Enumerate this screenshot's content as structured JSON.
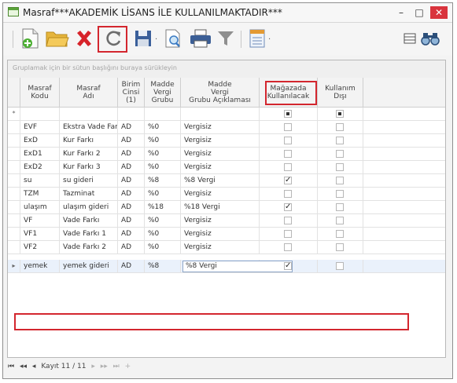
{
  "window": {
    "title": "Masraf***AKADEMİK LİSANS İLE KULLANILMAKTADIR***",
    "minimize": "–",
    "maximize": "□",
    "close": "✕"
  },
  "toolbar": {
    "dropdown_arrow": "·"
  },
  "grid": {
    "group_hint": "Gruplamak için bir sütun başlığını buraya sürükleyin",
    "headers": [
      "Masraf\nKodu",
      "Masraf\nAdı",
      "Birim\nCinsi\n(1)",
      "Madde\nVergi\nGrubu",
      "Madde\nVergi\nGrubu Açıklaması",
      "Mağazada\nKullanılacak",
      "Kullanım\nDışı"
    ],
    "new_row_marker": "*",
    "rows": [
      {
        "kod": "EVF",
        "adi": "Ekstra Vade Farkı",
        "birim": "AD",
        "grup": "%0",
        "aciklama": "Vergisiz",
        "magaza": false,
        "disi": false
      },
      {
        "kod": "ExD",
        "adi": "Kur Farkı",
        "birim": "AD",
        "grup": "%0",
        "aciklama": "Vergisiz",
        "magaza": false,
        "disi": false
      },
      {
        "kod": "ExD1",
        "adi": "Kur Farkı 2",
        "birim": "AD",
        "grup": "%0",
        "aciklama": "Vergisiz",
        "magaza": false,
        "disi": false
      },
      {
        "kod": "ExD2",
        "adi": "Kur Farkı 3",
        "birim": "AD",
        "grup": "%0",
        "aciklama": "Vergisiz",
        "magaza": false,
        "disi": false
      },
      {
        "kod": "su",
        "adi": "su gideri",
        "birim": "AD",
        "grup": "%8",
        "aciklama": "%8 Vergi",
        "magaza": true,
        "disi": false
      },
      {
        "kod": "TZM",
        "adi": "Tazminat",
        "birim": "AD",
        "grup": "%0",
        "aciklama": "Vergisiz",
        "magaza": false,
        "disi": false
      },
      {
        "kod": "ulaşım",
        "adi": "ulaşım gideri",
        "birim": "AD",
        "grup": "%18",
        "aciklama": "%18 Vergi",
        "magaza": true,
        "disi": false
      },
      {
        "kod": "VF",
        "adi": "Vade Farkı",
        "birim": "AD",
        "grup": "%0",
        "aciklama": "Vergisiz",
        "magaza": false,
        "disi": false
      },
      {
        "kod": "VF1",
        "adi": "Vade Farkı 1",
        "birim": "AD",
        "grup": "%0",
        "aciklama": "Vergisiz",
        "magaza": false,
        "disi": false
      },
      {
        "kod": "VF2",
        "adi": "Vade Farkı 2",
        "birim": "AD",
        "grup": "%0",
        "aciklama": "Vergisiz",
        "magaza": false,
        "disi": false
      },
      {
        "kod": "yemek",
        "adi": "yemek gideri",
        "birim": "AD",
        "grup": "%8",
        "aciklama": "%8 Vergi",
        "magaza": true,
        "disi": false
      }
    ],
    "current_row_marker": "▸"
  },
  "navigator": {
    "first": "⏮",
    "prev_page": "◂◂",
    "prev": "◂",
    "record_text": "Kayıt 11 / 11",
    "next": "▸",
    "next_page": "▸▸",
    "last": "⏭",
    "add": "+"
  },
  "colors": {
    "highlight": "#d3262e",
    "close_button": "#d9343d",
    "selected_row": "#eaf1fb"
  }
}
